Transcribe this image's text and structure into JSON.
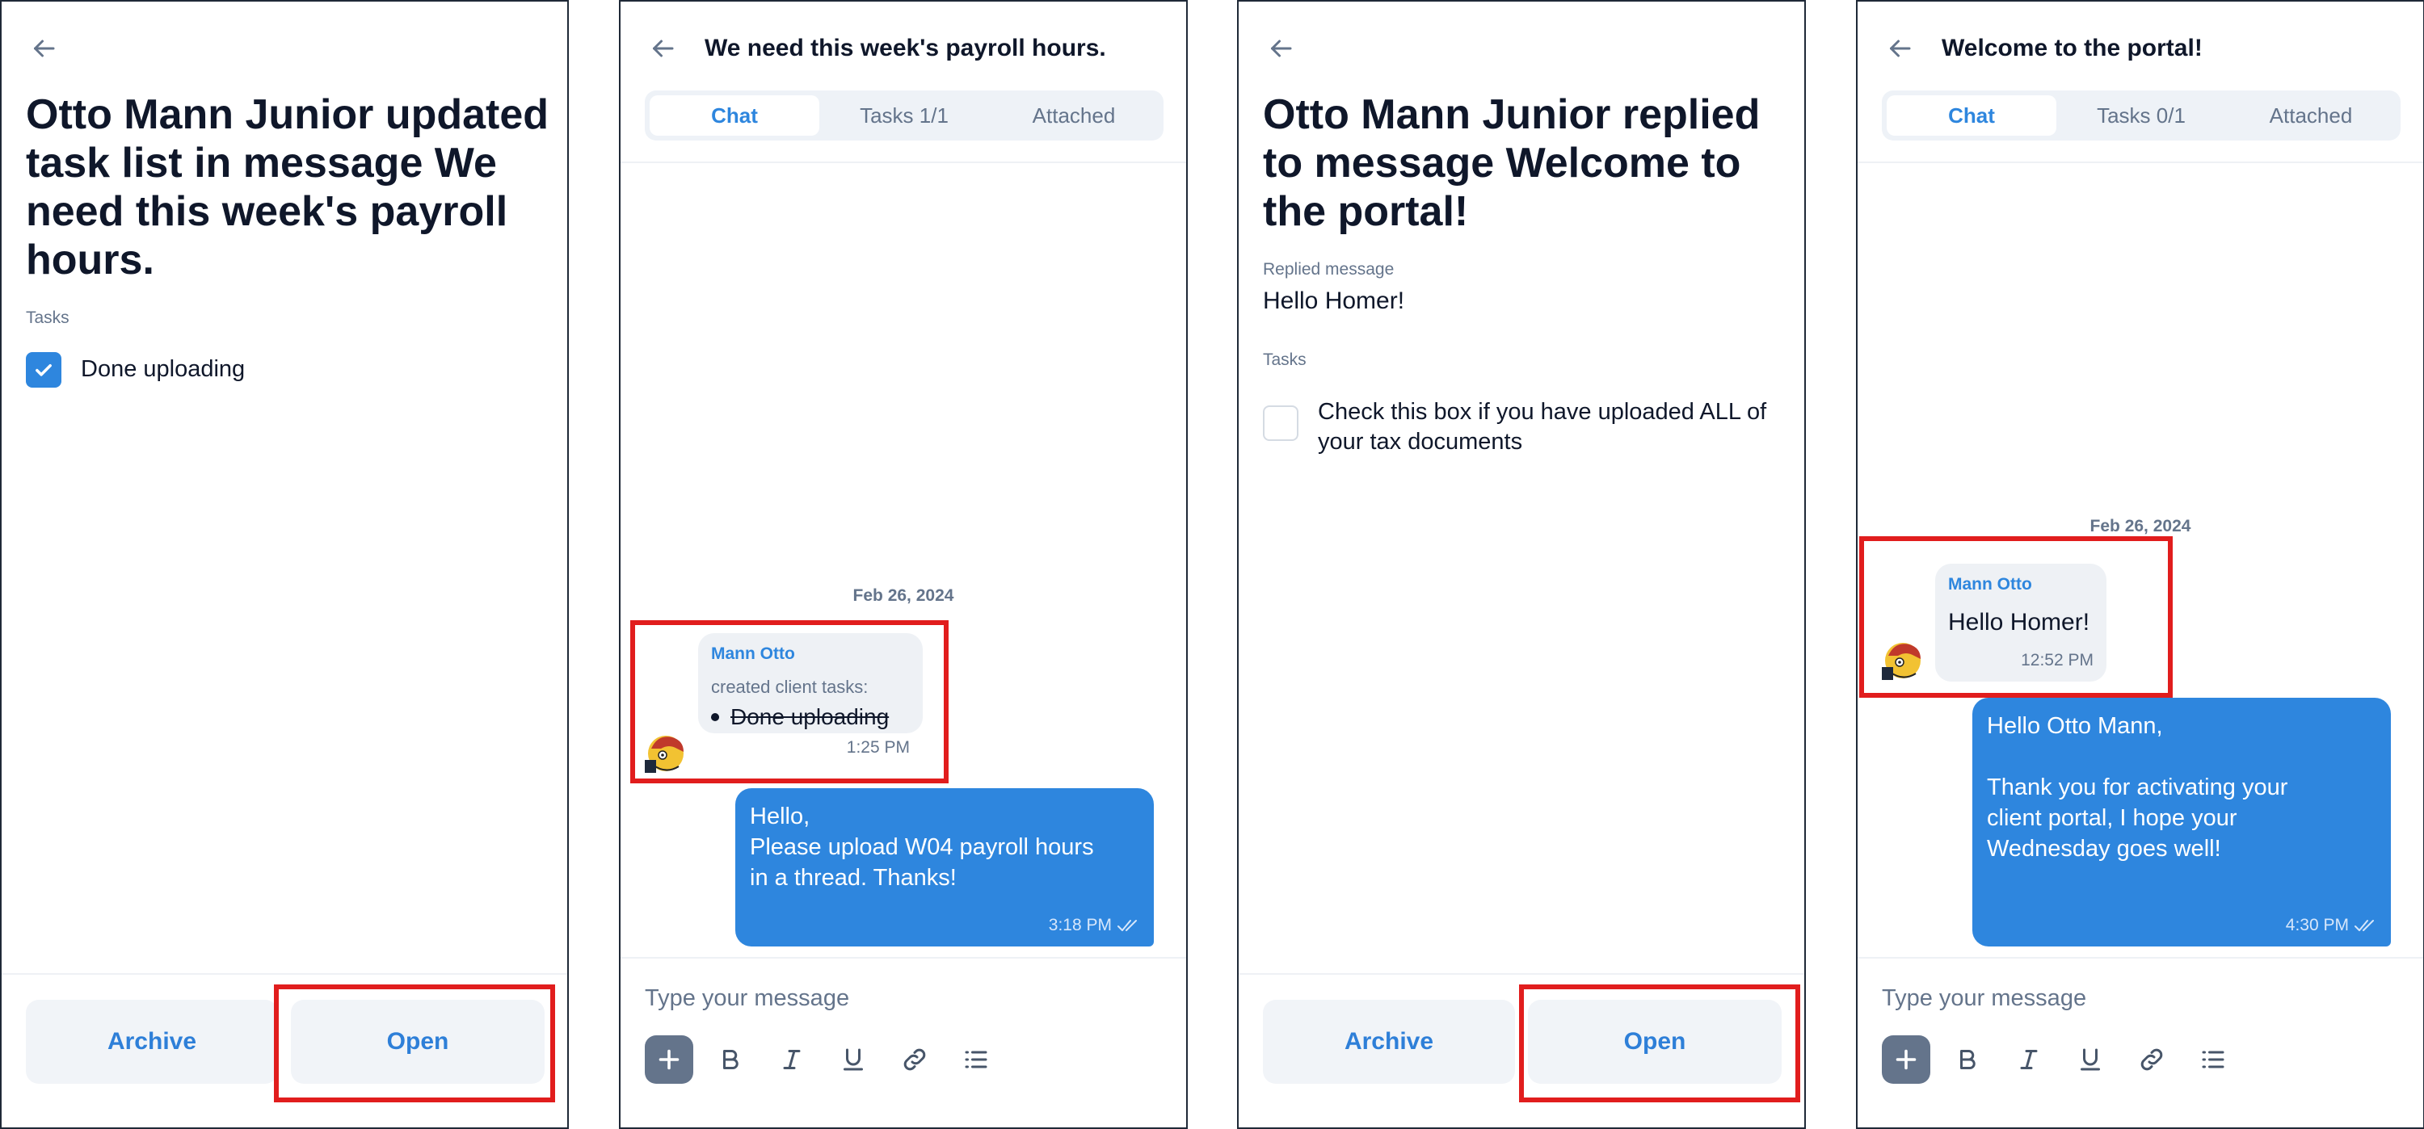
{
  "screen1": {
    "title": "Otto Mann Junior updated task list in message We need this week's payroll hours.",
    "tasks_label": "Tasks",
    "task": "Done uploading",
    "archive": "Archive",
    "open": "Open"
  },
  "screen2": {
    "title": "We need this week's payroll hours.",
    "tabs": [
      {
        "label": "Chat"
      },
      {
        "label": "Tasks 1/1"
      },
      {
        "label": "Attached"
      }
    ],
    "date": "Feb 26, 2024",
    "incoming": {
      "sender": "Mann Otto",
      "meta": "created client tasks:",
      "task": "Done uploading",
      "time": "1:25 PM"
    },
    "outgoing": {
      "text": "Hello,\nPlease upload W04 payroll hours\nin a thread. Thanks!",
      "time": "3:18 PM"
    },
    "placeholder": "Type your message"
  },
  "screen3": {
    "title": "Otto Mann Junior replied to message Welcome to the portal!",
    "replied_label": "Replied message",
    "replied_value": "Hello Homer!",
    "tasks_label": "Tasks",
    "task": "Check this box if you have uploaded ALL of your tax documents",
    "archive": "Archive",
    "open": "Open"
  },
  "screen4": {
    "title": "Welcome to the portal!",
    "tabs": [
      {
        "label": "Chat"
      },
      {
        "label": "Tasks 0/1"
      },
      {
        "label": "Attached"
      }
    ],
    "date": "Feb 26, 2024",
    "incoming": {
      "sender": "Mann Otto",
      "text": "Hello Homer!",
      "time": "12:52 PM"
    },
    "outgoing": {
      "text": "Hello Otto Mann,\n\nThank you for activating your\nclient portal, I hope your\nWednesday goes well!",
      "time": "4:30 PM"
    },
    "placeholder": "Type your message"
  },
  "colors": {
    "accent": "#2e86de",
    "highlight": "#e11d1d"
  },
  "icons": [
    "back-arrow-icon",
    "checkmark-icon",
    "double-check-icon",
    "plus-icon",
    "bold-icon",
    "italic-icon",
    "underline-icon",
    "link-icon",
    "list-icon",
    "avatar-icon"
  ]
}
